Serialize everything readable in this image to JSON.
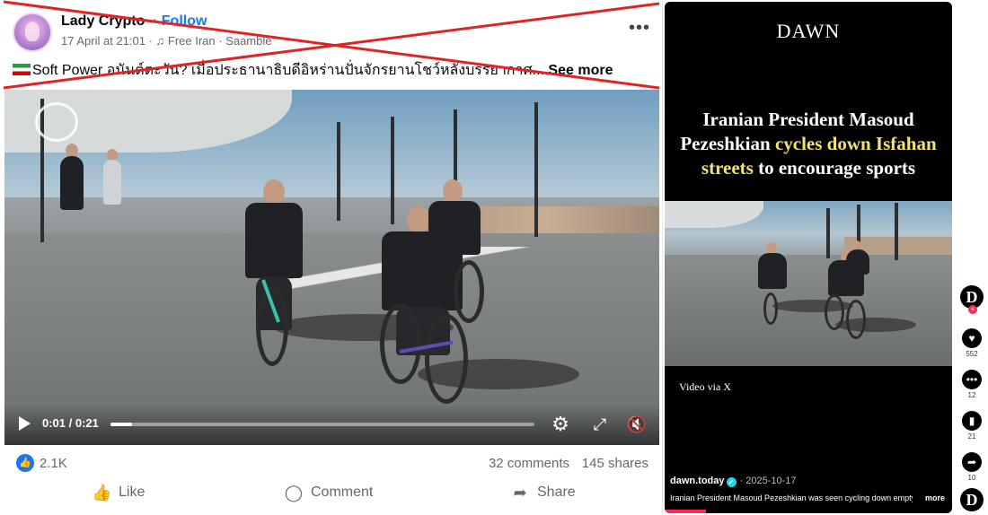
{
  "facebook_post": {
    "author": "Lady Crypto",
    "follow_label": "· Follow",
    "meta": "17 April at 21:01 · ♫ Free Iran · Saamble",
    "more_icon": "more-dots-icon",
    "caption": "Soft Power อนันต์ตะวัน? เมื่อประธานาธิบดีอิหร่านปั่นจักรยานโชว์หลังบรรยากาศ...",
    "see_more": "See more",
    "crossed_out_color": "#e02424",
    "video": {
      "time": "0:01 / 0:21",
      "progress": 0.05,
      "controls": [
        "play-icon",
        "gear-icon",
        "expand-icon",
        "mute-icon"
      ]
    },
    "stats": {
      "likes": "2.1K",
      "comments": "32 comments",
      "shares": "145 shares"
    },
    "actions": {
      "like": "Like",
      "comment": "Comment",
      "share": "Share"
    },
    "accent_color": "#1877f2"
  },
  "dawn_panel": {
    "logo": "DAWN",
    "headline_parts": {
      "a": "Iranian President Masoud Pezeshkian ",
      "b": "cycles down Isfahan streets",
      "c": " to encourage sports"
    },
    "highlight_color": "#f3e46b",
    "video_credit": "Video via X",
    "handle": "dawn.today",
    "date": "· 2025-10-17",
    "description": "Iranian President Masoud Pezeshkian was seen cycling down empty",
    "more": "more"
  },
  "side_rail": {
    "profile_letter": "D",
    "likes": "552",
    "comments": "12",
    "saves": "21",
    "shares": "10",
    "bottom_letter": "D"
  }
}
